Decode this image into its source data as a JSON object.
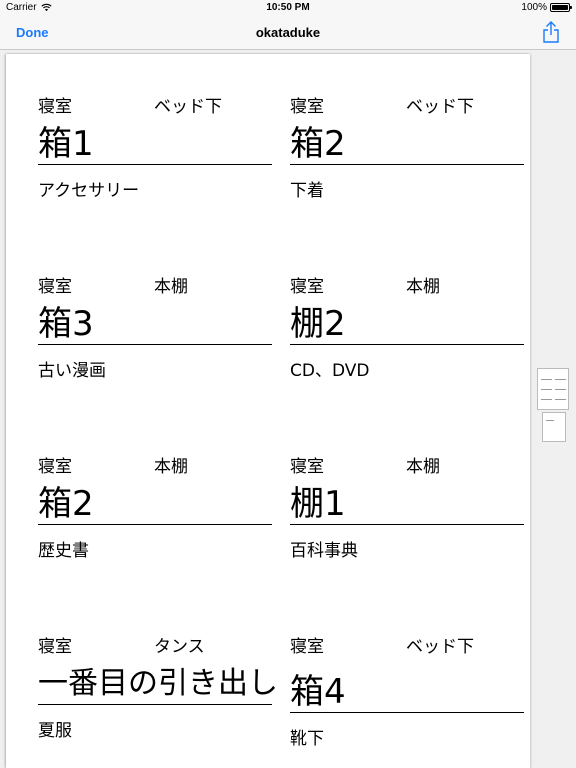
{
  "status_bar": {
    "carrier": "Carrier",
    "time": "10:50 PM",
    "battery": "100%"
  },
  "nav": {
    "done_label": "Done",
    "title": "okataduke"
  },
  "labels": [
    {
      "room": "寝室",
      "location": "ベッド下",
      "name": "箱1",
      "contents": "アクセサリー"
    },
    {
      "room": "寝室",
      "location": "ベッド下",
      "name": "箱2",
      "contents": "下着"
    },
    {
      "room": "寝室",
      "location": "本棚",
      "name": "箱3",
      "contents": "古い漫画"
    },
    {
      "room": "寝室",
      "location": "本棚",
      "name": "棚2",
      "contents": "CD、DVD"
    },
    {
      "room": "寝室",
      "location": "本棚",
      "name": "箱2",
      "contents": "歴史書"
    },
    {
      "room": "寝室",
      "location": "本棚",
      "name": "棚1",
      "contents": "百科事典"
    },
    {
      "room": "寝室",
      "location": "タンス",
      "name": "一番目の引き出し",
      "contents": "夏服"
    },
    {
      "room": "寝室",
      "location": "ベッド下",
      "name": "箱4",
      "contents": "靴下"
    }
  ],
  "colors": {
    "accent": "#1a7bff"
  }
}
